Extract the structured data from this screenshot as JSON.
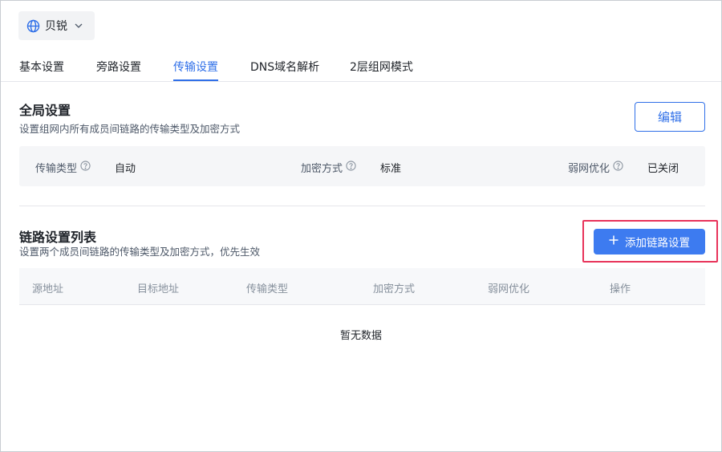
{
  "account": {
    "name": "贝锐",
    "icon": "globe-icon",
    "dropdown_icon": "chevron-down-icon"
  },
  "tabs": [
    {
      "label": "基本设置",
      "active": false
    },
    {
      "label": "旁路设置",
      "active": false
    },
    {
      "label": "传输设置",
      "active": true
    },
    {
      "label": "DNS域名解析",
      "active": false
    },
    {
      "label": "2层组网模式",
      "active": false
    }
  ],
  "global": {
    "title": "全局设置",
    "description": "设置组网内所有成员间链路的传输类型及加密方式",
    "edit_label": "编辑",
    "fields": [
      {
        "label": "传输类型",
        "value": "自动"
      },
      {
        "label": "加密方式",
        "value": "标准"
      },
      {
        "label": "弱网优化",
        "value": "已关闭"
      }
    ]
  },
  "links": {
    "title": "链路设置列表",
    "description": "设置两个成员间链路的传输类型及加密方式，优先生效",
    "add_label": "添加链路设置",
    "columns": [
      "源地址",
      "目标地址",
      "传输类型",
      "加密方式",
      "弱网优化",
      "操作"
    ],
    "empty_text": "暂无数据"
  },
  "colors": {
    "accent": "#2f6fe8",
    "button_primary": "#3d7bf0",
    "highlight": "#e8335a"
  }
}
